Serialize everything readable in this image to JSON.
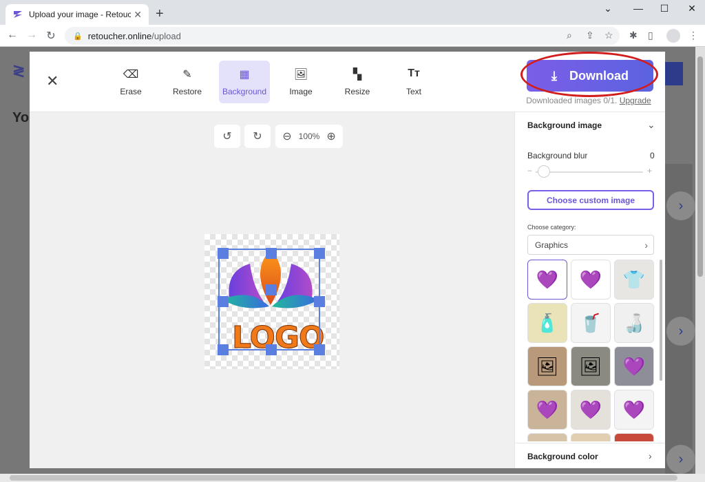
{
  "browser": {
    "tab_title": "Upload your image - Retoucher.online",
    "new_tab": "+",
    "url_domain": "retoucher.online",
    "url_path": "/upload"
  },
  "background_page": {
    "heading_partial": "Yo"
  },
  "toolbar": {
    "tools": [
      {
        "label": "Erase",
        "icon": "eraser-icon"
      },
      {
        "label": "Restore",
        "icon": "brush-icon"
      },
      {
        "label": "Background",
        "icon": "checkerboard-icon",
        "active": true
      },
      {
        "label": "Image",
        "icon": "image-icon"
      },
      {
        "label": "Resize",
        "icon": "layout-icon"
      },
      {
        "label": "Text",
        "icon": "text-icon"
      }
    ],
    "download_label": "Download",
    "download_note": "Downloaded images 0/1.",
    "upgrade_link": "Upgrade",
    "accent_color": "#6a57d6"
  },
  "canvas": {
    "zoom": "100%",
    "logo_text": "LOGO"
  },
  "panel": {
    "background_image_title": "Background image",
    "blur_label": "Background blur",
    "blur_value": "0",
    "custom_image_button": "Choose custom image",
    "category_label": "Choose category:",
    "category_value": "Graphics",
    "background_color_title": "Background color"
  }
}
